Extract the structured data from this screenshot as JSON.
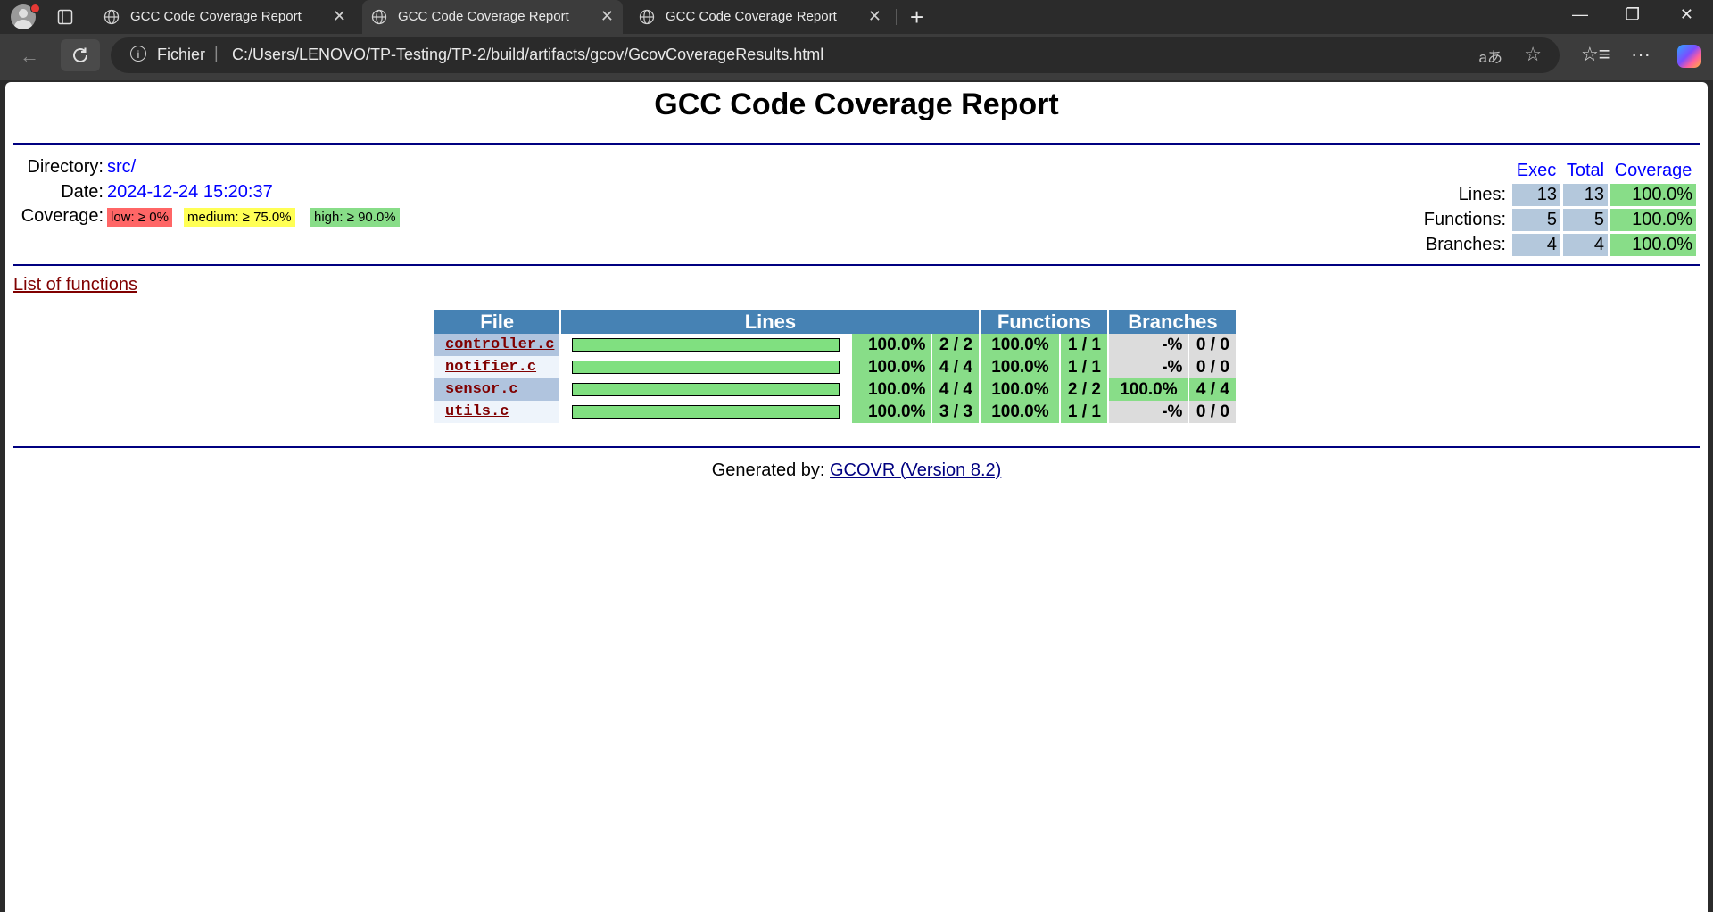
{
  "browser": {
    "tabs": [
      {
        "title": "GCC Code Coverage Report"
      },
      {
        "title": "GCC Code Coverage Report"
      },
      {
        "title": "GCC Code Coverage Report"
      }
    ],
    "address": {
      "scheme_label": "Fichier",
      "url": "C:/Users/LENOVO/TP-Testing/TP-2/build/artifacts/gcov/GcovCoverageResults.html"
    }
  },
  "report": {
    "title": "GCC Code Coverage Report",
    "meta": {
      "directory_label": "Directory:",
      "directory_value": "src/",
      "date_label": "Date:",
      "date_value": "2024-12-24 15:20:37",
      "coverage_label": "Coverage:",
      "legend": {
        "low": "low: ≥ 0%",
        "medium": "medium: ≥ 75.0%",
        "high": "high: ≥ 90.0%"
      }
    },
    "summary": {
      "headers": [
        "Exec",
        "Total",
        "Coverage"
      ],
      "rows": [
        {
          "label": "Lines:",
          "exec": "13",
          "total": "13",
          "coverage": "100.0%"
        },
        {
          "label": "Functions:",
          "exec": "5",
          "total": "5",
          "coverage": "100.0%"
        },
        {
          "label": "Branches:",
          "exec": "4",
          "total": "4",
          "coverage": "100.0%"
        }
      ]
    },
    "list_of_functions_link": "List of functions",
    "table": {
      "headers": {
        "file": "File",
        "lines": "Lines",
        "functions": "Functions",
        "branches": "Branches"
      },
      "rows": [
        {
          "file": "controller.c",
          "line_fraction": 1.0,
          "line_pct": "100.0%",
          "line_count": "2 / 2",
          "func_pct": "100.0%",
          "func_count": "1 / 1",
          "branch_pct": "-%",
          "branch_count": "0 / 0"
        },
        {
          "file": "notifier.c",
          "line_fraction": 1.0,
          "line_pct": "100.0%",
          "line_count": "4 / 4",
          "func_pct": "100.0%",
          "func_count": "1 / 1",
          "branch_pct": "-%",
          "branch_count": "0 / 0"
        },
        {
          "file": "sensor.c",
          "line_fraction": 1.0,
          "line_pct": "100.0%",
          "line_count": "4 / 4",
          "func_pct": "100.0%",
          "func_count": "2 / 2",
          "branch_pct": "100.0%",
          "branch_count": "4 / 4"
        },
        {
          "file": "utils.c",
          "line_fraction": 1.0,
          "line_pct": "100.0%",
          "line_count": "3 / 3",
          "func_pct": "100.0%",
          "func_count": "1 / 1",
          "branch_pct": "-%",
          "branch_count": "0 / 0"
        }
      ]
    },
    "footer": {
      "prefix": "Generated by:",
      "link": "GCOVR (Version 8.2)"
    },
    "colors": {
      "low": "#ff6666",
      "medium": "#ffff55",
      "high": "#88dd88",
      "header_bg": "#4682b4",
      "rule": "#000080"
    }
  }
}
